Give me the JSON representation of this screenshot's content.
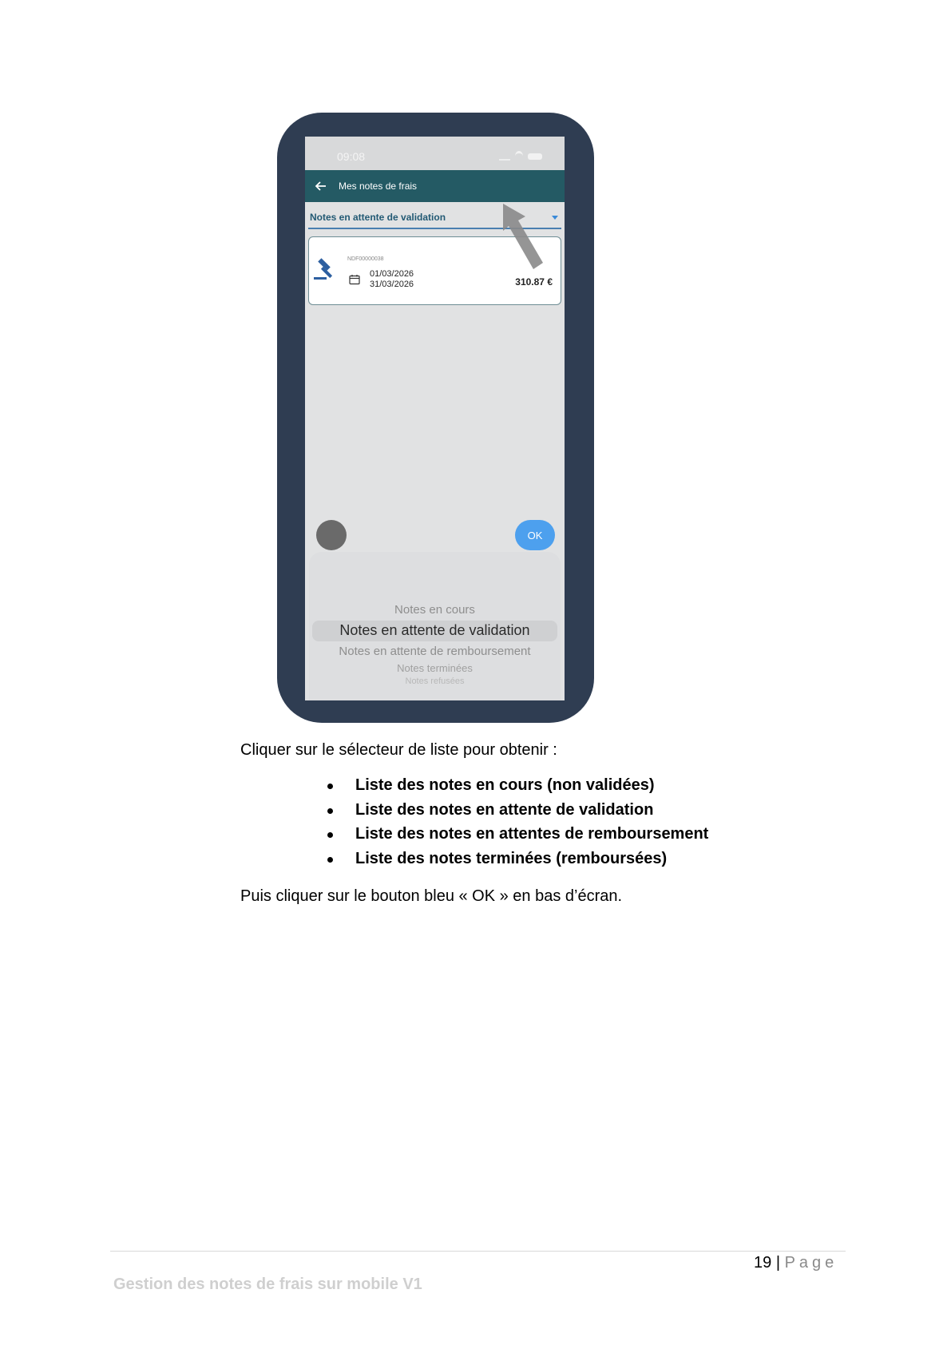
{
  "phone": {
    "status_time": "09:08",
    "appbar_title": "Mes notes de frais",
    "selector_value": "Notes en attente de validation",
    "card": {
      "reference": "NDF00000038",
      "date_start": "01/03/2026",
      "date_end": "31/03/2026",
      "amount": "310.87 €"
    },
    "ok_label": "OK",
    "picker_items": [
      "Notes en cours",
      "Notes en attente de validation",
      "Notes en attente de remboursement",
      "Notes terminées",
      "Notes refusées"
    ],
    "colors": {
      "appbar": "#245a64",
      "ok_button": "#4da0ee",
      "frame": "#2f3d52"
    }
  },
  "doc": {
    "intro": "Cliquer sur le sélecteur de liste pour obtenir :",
    "bullets": [
      "Liste des notes en cours (non validées)",
      "Liste des notes en attente de validation",
      "Liste des notes en attentes de remboursement",
      "Liste des notes terminées (remboursées)"
    ],
    "outro": "Puis cliquer sur le bouton bleu « OK » en bas d’écran."
  },
  "footer": {
    "page_number": "19",
    "separator": "|",
    "page_word": "Page",
    "title": "Gestion des notes de frais sur mobile V1"
  }
}
